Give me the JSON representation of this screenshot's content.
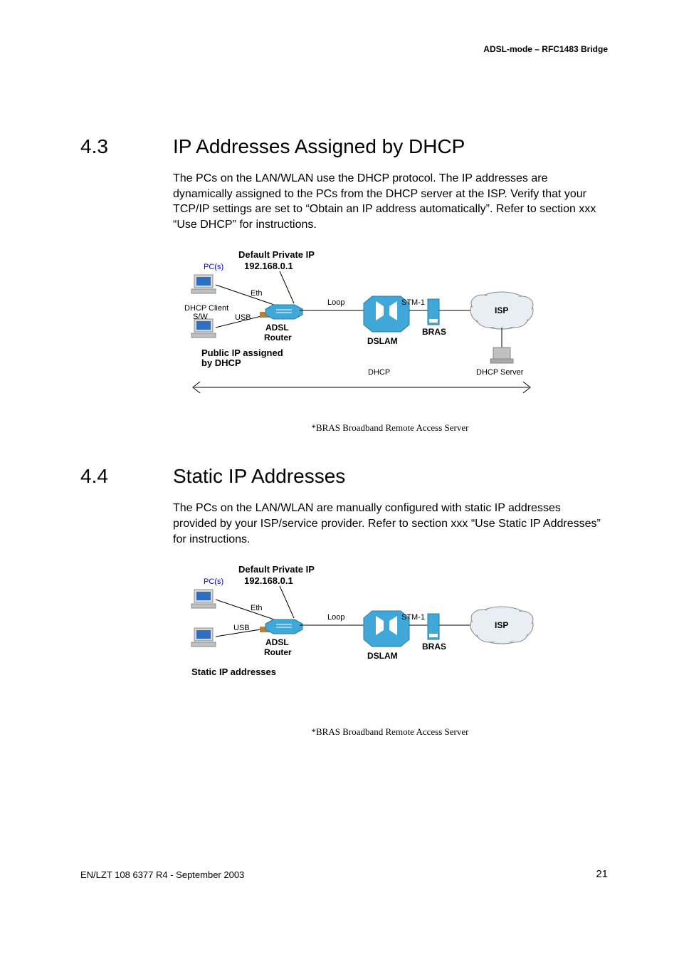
{
  "header": {
    "right": "ADSL-mode – RFC1483 Bridge"
  },
  "sections": [
    {
      "num": "4.3",
      "title": "IP Addresses Assigned by DHCP",
      "body": "The PCs on the LAN/WLAN use the DHCP protocol. The IP addresses are dynamically assigned to the PCs from the DHCP server at the ISP. Verify that your TCP/IP settings are set to “Obtain an IP address automatically”. Refer to section xxx “Use DHCP” for instructions.",
      "footnote": "*BRAS   Broadband Remote Access Server"
    },
    {
      "num": "4.4",
      "title": "Static IP Addresses",
      "body": "The PCs on the LAN/WLAN are manually configured with static IP addresses provided by your ISP/service provider. Refer to section xxx “Use Static IP Addresses” for instructions.",
      "footnote": "*BRAS   Broadband Remote Access Server"
    }
  ],
  "diagram": {
    "pcs": "PC(s)",
    "default_ip_title": "Default Private IP",
    "default_ip": "192.168.0.1",
    "eth": "Eth",
    "usb": "USB",
    "adsl_router1": "ADSL",
    "adsl_router2": "Router",
    "loop": "Loop",
    "dslam": "DSLAM",
    "stm1": "STM-1",
    "bras": "BRAS",
    "isp": "ISP",
    "dhcp_client1": "DHCP  Client",
    "dhcp_client2": "S/W",
    "public_ip1": "Public IP assigned",
    "public_ip2": "by DHCP",
    "dhcp": "DHCP",
    "dhcp_server": "DHCP Server",
    "static_ip": "Static IP addresses"
  },
  "footer": {
    "left": "EN/LZT 108 6377 R4 - September 2003",
    "right": "21"
  }
}
